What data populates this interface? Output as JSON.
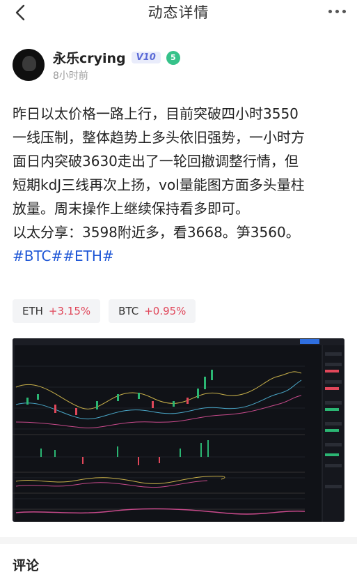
{
  "header": {
    "title": "动态详情"
  },
  "author": {
    "name": "永乐crying",
    "vip": "V10",
    "level": "5",
    "time": "8小时前"
  },
  "post": {
    "lines": [
      "昨日以太价格一路上行，目前突破四小时3550",
      "一线压制，整体趋势上多头依旧强势，一小时方",
      "面日内突破3630走出了一轮回撤调整行情，但",
      "短期kdJ三线再次上扬，vol量能图方面多头量柱",
      "放量。周末操作上继续保持看多即可。",
      "以太分享：3598附近多，看3668。笋3560。"
    ],
    "tags": "#BTC##ETH#"
  },
  "coins": [
    {
      "symbol": "ETH",
      "change": "+3.15%"
    },
    {
      "symbol": "BTC",
      "change": "+0.95%"
    }
  ],
  "comments": {
    "title": "评论"
  },
  "colors": {
    "up": "#e0475a",
    "tag": "#1f57d6",
    "level_badge": "#36c28a",
    "vip_text": "#5b6ad6"
  }
}
